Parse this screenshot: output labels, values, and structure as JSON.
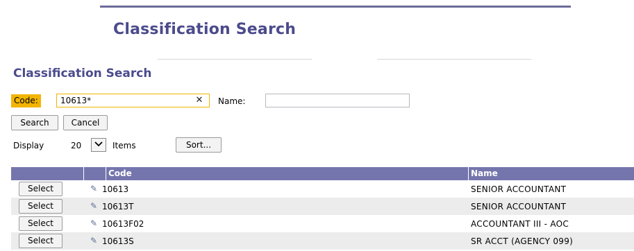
{
  "header": {
    "title": "Classification Search"
  },
  "search": {
    "title": "Classification Search",
    "code_label": "Code:",
    "code_value": "10613*",
    "name_label": "Name:",
    "name_value": "",
    "search_button": "Search",
    "cancel_button": "Cancel",
    "display_label": "Display",
    "display_value": "20",
    "items_label": "Items",
    "sort_button": "Sort..."
  },
  "icons": {
    "clear": "close-icon",
    "dropdown": "chevron-down-icon",
    "edit": "pencil-icon"
  },
  "colors": {
    "title": "#4b4b8c",
    "header_bg": "#7575ad",
    "code_label_bg": "#f2b400"
  },
  "table": {
    "columns": [
      "Code",
      "Name"
    ],
    "select_label": "Select",
    "rows": [
      {
        "code": "10613",
        "name": "SENIOR ACCOUNTANT"
      },
      {
        "code": "10613T",
        "name": "SENIOR ACCOUNTANT"
      },
      {
        "code": "10613F02",
        "name": "ACCOUNTANT III - AOC"
      },
      {
        "code": "10613S",
        "name": "SR ACCT (AGENCY 099)"
      }
    ]
  }
}
